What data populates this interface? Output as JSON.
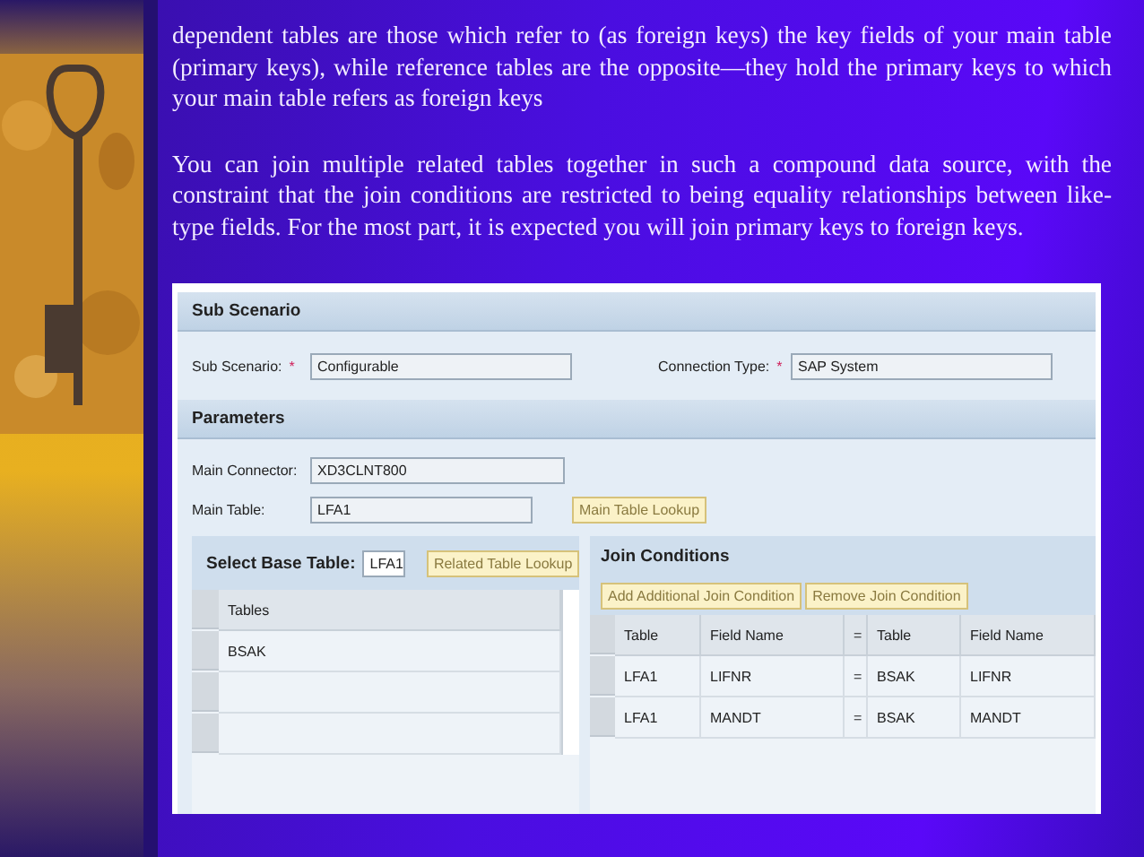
{
  "side_picture": {
    "kind": "picture"
  },
  "paragraphs": [
    "dependent tables are those which refer to (as foreign keys) the key fields of your main table (primary keys), while reference tables are the opposite—they hold the primary keys to which your main table refers as foreign keys",
    "You can join multiple related tables together in such a compound data source, with the constraint that the join conditions are restricted to being equality relationships between like-type fields. For the most part, it is expected you will join primary keys to foreign keys."
  ],
  "screenshot": {
    "sub_scenario": {
      "title": "Sub Scenario",
      "fields": [
        {
          "label": "Sub Scenario:",
          "required_mark": "*",
          "value": "Configurable"
        },
        {
          "label": "Connection Type:",
          "required_mark": "*",
          "value": "SAP System"
        }
      ]
    },
    "parameters": {
      "title": "Parameters",
      "main_connector": {
        "label": "Main Connector:",
        "value": "XD3CLNT800"
      },
      "main_table": {
        "label": "Main Table:",
        "value": "LFA1",
        "button": "Main Table Lookup"
      }
    },
    "base_table": {
      "label": "Select Base Table:",
      "value": "LFA1",
      "button": "Related Table Lookup",
      "column": "Tables",
      "rows": [
        {
          "name": "BSAK"
        },
        {
          "name": ""
        },
        {
          "name": ""
        }
      ]
    },
    "join_conditions": {
      "title": "Join Conditions",
      "buttons": [
        "Add Additional Join Condition",
        "Remove Join Condition"
      ],
      "columns": [
        "Table",
        "Field Name",
        "=",
        "Table",
        "Field Name"
      ],
      "rows": [
        [
          "LFA1",
          "LIFNR",
          "=",
          "BSAK",
          "LIFNR"
        ],
        [
          "LFA1",
          "MANDT",
          "=",
          "BSAK",
          "MANDT"
        ]
      ]
    }
  }
}
